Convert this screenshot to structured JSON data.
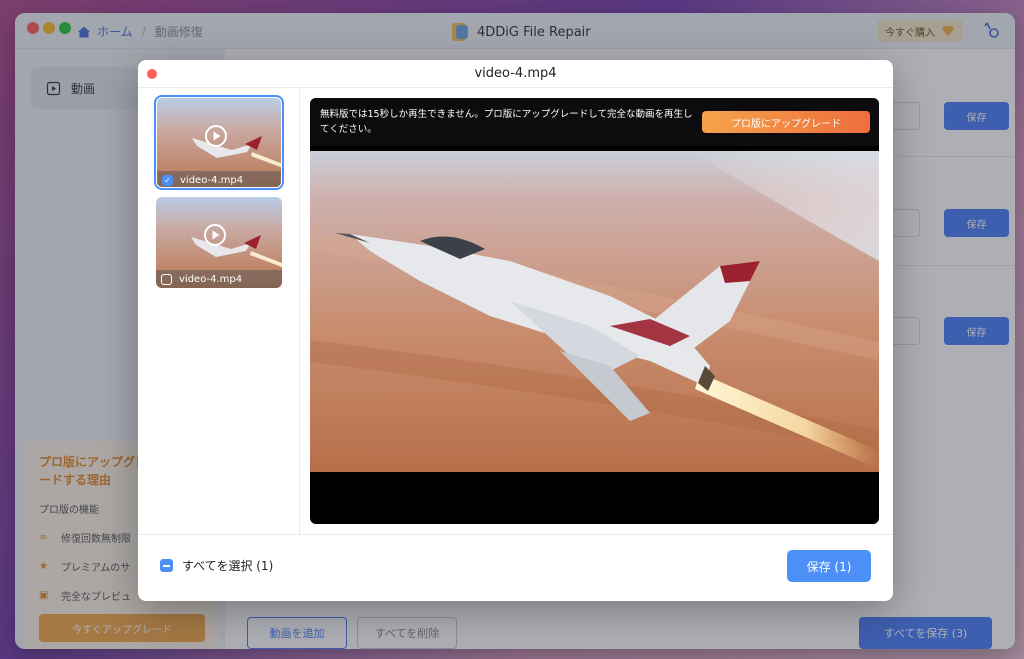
{
  "titlebar": {
    "breadcrumb_home": "ホーム",
    "breadcrumb_sep": "/",
    "breadcrumb_current": "動画修復",
    "app_title": "4DDiG File Repair",
    "buy_label": "今すぐ購入"
  },
  "sidebar": {
    "items": [
      {
        "label": "動画",
        "icon": "video-icon"
      }
    ],
    "promo": {
      "title": "プロ版にアップグレードする理由",
      "features_title": "プロ版の機能",
      "features": [
        {
          "icon": "infinity-icon",
          "label": "修復回数無制限"
        },
        {
          "icon": "star-icon",
          "label": "プレミアムのサ"
        },
        {
          "icon": "preview-icon",
          "label": "完全なプレビュ"
        }
      ],
      "button": "今すぐアップグレード"
    }
  },
  "main": {
    "rows": [
      {
        "save_label": "保存"
      },
      {
        "save_label": "保存"
      },
      {
        "save_label": "保存"
      }
    ],
    "add_label": "動画を追加",
    "delete_all_label": "すべてを削除",
    "save_all_label": "すべてを保存 (3)"
  },
  "modal": {
    "title": "video-4.mp4",
    "thumbnails": [
      {
        "label": "video-4.mp4",
        "checked": true
      },
      {
        "label": "video-4.mp4",
        "checked": false
      }
    ],
    "notice": "無料版では15秒しか再生できません。プロ版にアップグレードして完全な動画を再生してください。",
    "upgrade_label": "プロ版にアップグレード",
    "select_all_label": "すべてを選択 (1)",
    "save_label": "保存 (1)"
  },
  "colors": {
    "accent": "#4c8ff6",
    "upgrade_gradient_start": "#f5a34b",
    "upgrade_gradient_end": "#ee6e3c",
    "close_dot": "#fe5f57"
  }
}
